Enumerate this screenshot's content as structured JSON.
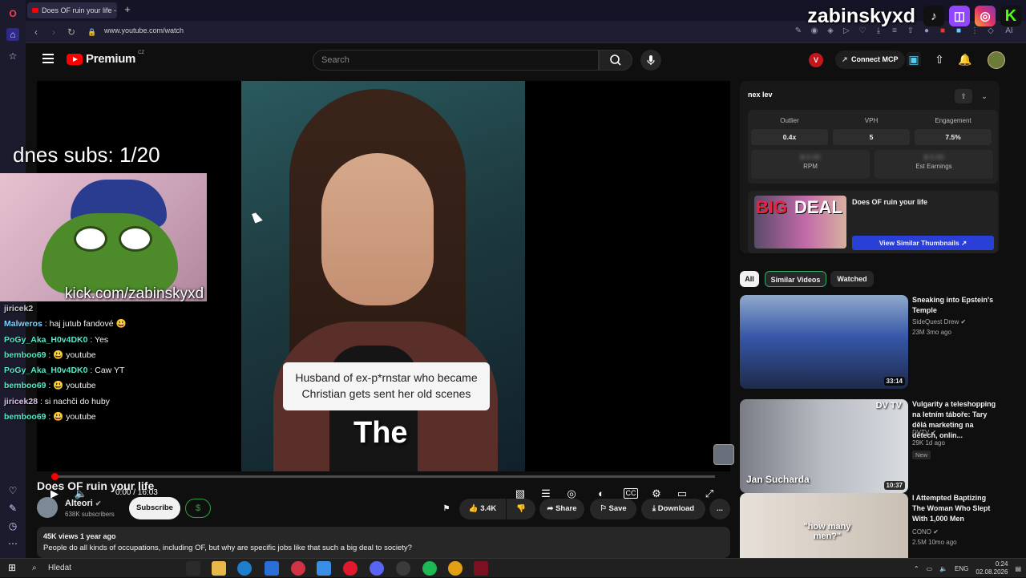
{
  "browser": {
    "tab_title": "Does OF ruin your life - Yo",
    "new_tab_symbol": "+",
    "url": "www.youtube.com/watch",
    "toolbar_right_label": "AI"
  },
  "stream_overlay": {
    "brand_name": "zabinskyxd",
    "subs_counter": "dnes subs: 1/20",
    "kick_url": "kick.com/zabinskyxd",
    "chat": [
      {
        "user": "jiricek2",
        "text": "",
        "color": "#c9c9c9"
      },
      {
        "user": "Malweros",
        "text": ": haj jutub fandové 😃",
        "color": "#7fd3ff"
      },
      {
        "user": "PoGy_Aka_H0v4DK0",
        "text": ": Yes",
        "color": "#58e7c7"
      },
      {
        "user": "bemboo69",
        "text": ": 😃 youtube",
        "color": "#58e7c7"
      },
      {
        "user": "PoGy_Aka_H0v4DK0",
        "text": ": Caw YT",
        "color": "#58e7c7"
      },
      {
        "user": "bemboo69",
        "text": ": 😃 youtube",
        "color": "#58e7c7"
      },
      {
        "user": "jiricek28",
        "text": ": si nachči do huby",
        "color": "#d7c3e8"
      },
      {
        "user": "bemboo69",
        "text": ": 😃 youtube",
        "color": "#58e7c7"
      }
    ]
  },
  "header": {
    "logo_text": "Premium",
    "logo_country": "CZ",
    "search_placeholder": "Search",
    "v_ext_label": "V",
    "connect_mcp_label": "Connect MCP"
  },
  "player": {
    "caption_box": "Husband of ex-p*rnstar who became Christian gets sent her old scenes",
    "caption_word": "The",
    "time": "0:00 / 16:03",
    "progress": 0.0
  },
  "video": {
    "title": "Does OF ruin your life",
    "channel": "Alteori",
    "subscribers": "638K subscribers",
    "subscribe_label": "Subscribe",
    "dollar_label": "$",
    "likes": "3.4K",
    "share_label": "Share",
    "save_label": "Save",
    "download_label": "Download",
    "more_label": "...",
    "views_age": "45K views  1 year ago",
    "description": "People do all kinds of occupations, including OF, but why are specific jobs like that such a big deal to society?"
  },
  "ext_panel": {
    "logo": "nex lev",
    "stats": [
      {
        "label": "Outlier",
        "value": "0.4x"
      },
      {
        "label": "VPH",
        "value": "5"
      },
      {
        "label": "Engagement",
        "value": "7.5%"
      }
    ],
    "blurred": [
      {
        "value": "$ 0.00",
        "label": "RPM"
      },
      {
        "value": "$ 0.00",
        "label": "Est Earnings"
      }
    ],
    "thumb_big": "BIG",
    "thumb_deal": "DEAL",
    "thumb_title": "Does OF ruin your life",
    "similar_btn": "View Similar Thumbnails ↗"
  },
  "chips": [
    "All",
    "Similar Videos",
    "Watched"
  ],
  "related": [
    {
      "title": "Sneaking into Epstein's Temple",
      "channel": "SideQuest Drew ✔",
      "meta": "23M  3mo ago",
      "duration": "33:14",
      "badge": ""
    },
    {
      "title": "Vulgarity a teleshopping na letním táboře: Tary dělá marketing na dětech, onlin...",
      "channel": "DVTV ✔",
      "meta": "29K  1d ago",
      "duration": "10:37",
      "badge": "New",
      "thumb_text": "Jan Sucharda",
      "thumb_logo": "DV TV"
    },
    {
      "title": "I Attempted Baptizing The Woman Who Slept With 1,000 Men",
      "channel": "CONO ✔",
      "meta": "2.5M  10mo ago",
      "duration": "",
      "badge": "",
      "thumb_text": "\"how many men?\""
    }
  ],
  "taskbar": {
    "search": "Hledat",
    "lang": "ENG",
    "time": "0:24",
    "date": "02.08.2026"
  }
}
